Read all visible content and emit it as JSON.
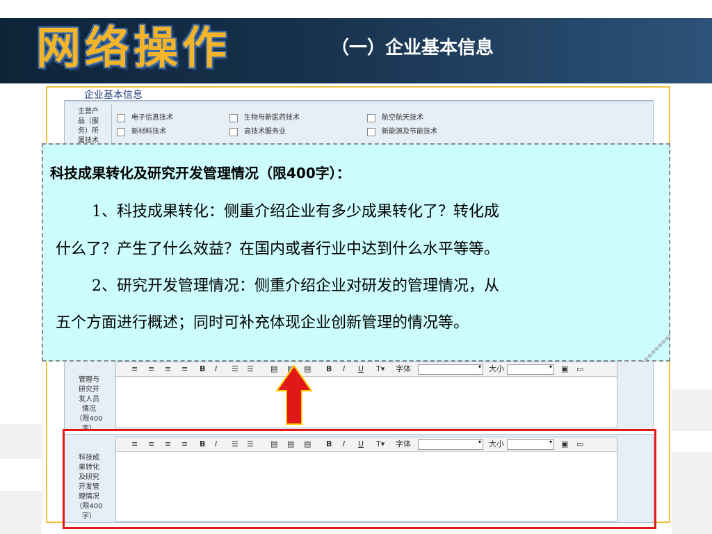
{
  "header": {
    "logo_text": "网络操作",
    "title": "（一）企业基本信息"
  },
  "form": {
    "heading": "企业基本信息",
    "main_products_label": [
      "主营产",
      "品（服",
      "务）所",
      "属技术"
    ],
    "checkboxes": [
      "电子信息技术",
      "生物与新医药技术",
      "航空航天技术",
      "新材料技术",
      "高技术服务业",
      "新能源及节能技术"
    ],
    "mgmt_label": [
      "管理与",
      "研究开",
      "发人员",
      "情况",
      "（限400",
      "字）"
    ],
    "transform_label": [
      "科技成",
      "果转化",
      "及研究",
      "开发管",
      "理情况",
      "（限400",
      "字）"
    ],
    "toolbar": {
      "bold": "B",
      "italic": "I",
      "underline": "U",
      "font_label": "字体",
      "size_label": "大小"
    }
  },
  "callout": {
    "heading": "科技成果转化及研究开发管理情况（限400字）：",
    "lines": [
      "1、科技成果转化：侧重介绍企业有多少成果转化了？转化成",
      "什么了？产生了什么效益？在国内或者行业中达到什么水平等等。",
      "2、研究开发管理情况：侧重介绍企业对研发的管理情况，从",
      "五个方面进行概述；同时可补充体现企业创新管理的情况等。"
    ]
  },
  "colors": {
    "header_bg": "#18324e",
    "logo": "#f3b42a",
    "callout_bg": "#ccfcfc",
    "highlight": "#e01818",
    "arrow": "#e01818",
    "frame": "#f2c23c"
  }
}
